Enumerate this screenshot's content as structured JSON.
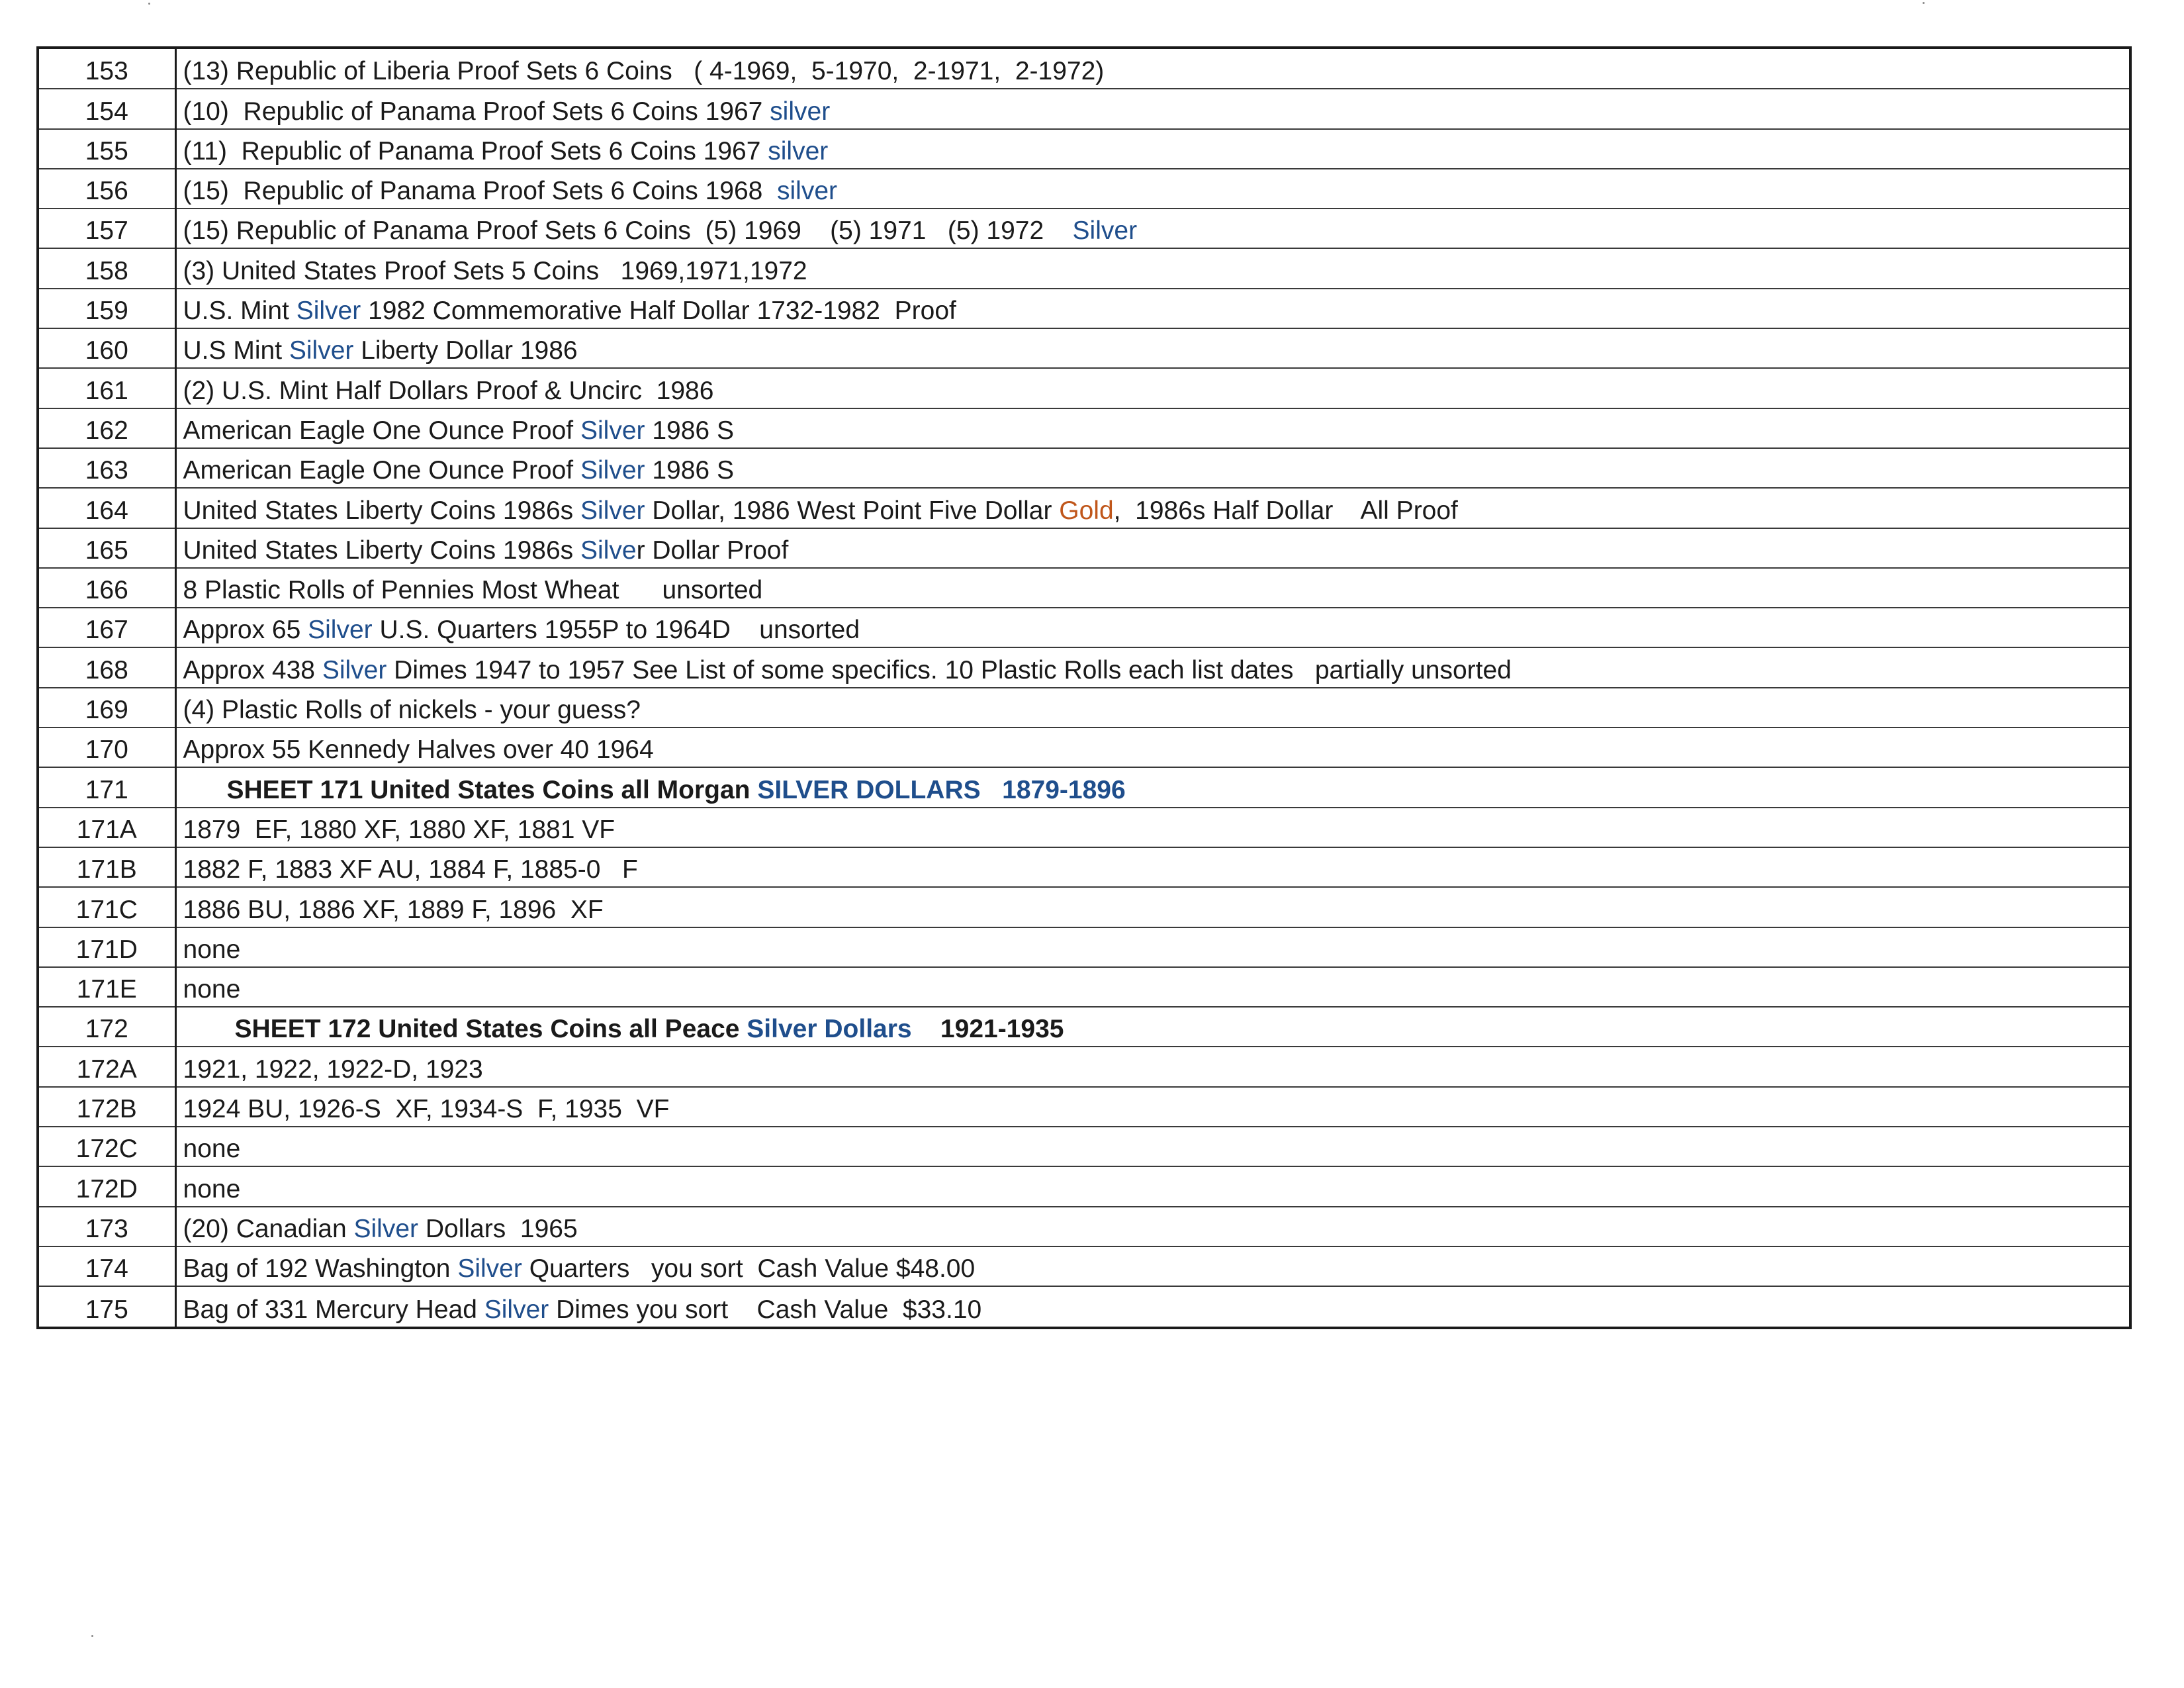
{
  "rows": [
    {
      "lot": "153",
      "desc": [
        {
          "t": "(13) Republic of Liberia Proof Sets 6 Coins   ( 4-1969,  5-1970,  2-1971,  2-1972)"
        }
      ]
    },
    {
      "lot": "154",
      "desc": [
        {
          "t": "(10)  Republic of Panama Proof Sets 6 Coins 1967 "
        },
        {
          "t": "silver",
          "c": "silver"
        }
      ]
    },
    {
      "lot": "155",
      "desc": [
        {
          "t": "(11)  Republic of Panama Proof Sets 6 Coins 1967 "
        },
        {
          "t": "silver",
          "c": "silver"
        }
      ]
    },
    {
      "lot": "156",
      "desc": [
        {
          "t": "(15)  Republic of Panama Proof Sets 6 Coins 1968  "
        },
        {
          "t": "silver",
          "c": "silver"
        }
      ]
    },
    {
      "lot": "157",
      "desc": [
        {
          "t": "(15) Republic of Panama Proof Sets 6 Coins  (5) 1969    (5) 1971   (5) 1972    "
        },
        {
          "t": "Silver",
          "c": "silver"
        }
      ]
    },
    {
      "lot": "158",
      "desc": [
        {
          "t": "(3) United States Proof Sets 5 Coins   1969,1971,1972"
        }
      ]
    },
    {
      "lot": "159",
      "desc": [
        {
          "t": "U.S. Mint "
        },
        {
          "t": "Silver",
          "c": "silver"
        },
        {
          "t": " 1982 Commemorative Half Dollar 1732-1982  Proof"
        }
      ]
    },
    {
      "lot": "160",
      "desc": [
        {
          "t": "U.S Mint "
        },
        {
          "t": "Silver",
          "c": "silver"
        },
        {
          "t": " Liberty Dollar 1986"
        }
      ]
    },
    {
      "lot": "161",
      "desc": [
        {
          "t": "(2) U.S. Mint Half Dollars Proof & Uncirc  1986"
        }
      ]
    },
    {
      "lot": "162",
      "desc": [
        {
          "t": "American Eagle One Ounce Proof "
        },
        {
          "t": "Silver",
          "c": "silver"
        },
        {
          "t": " 1986 S"
        }
      ]
    },
    {
      "lot": "163",
      "desc": [
        {
          "t": "American Eagle One Ounce Proof "
        },
        {
          "t": "Silver",
          "c": "silver"
        },
        {
          "t": " 1986 S"
        }
      ]
    },
    {
      "lot": "164",
      "desc": [
        {
          "t": "United States Liberty Coins 1986s "
        },
        {
          "t": "Silver",
          "c": "silver"
        },
        {
          "t": " Dollar, 1986 West Point Five Dollar "
        },
        {
          "t": "Gold",
          "c": "gold"
        },
        {
          "t": ",  1986s Half Dollar    All Proof"
        }
      ]
    },
    {
      "lot": "165",
      "desc": [
        {
          "t": "United States Liberty Coins 1986s "
        },
        {
          "t": "Silve",
          "c": "silver"
        },
        {
          "t": "r Dollar Proof"
        }
      ]
    },
    {
      "lot": "166",
      "desc": [
        {
          "t": "8 Plastic Rolls of Pennies Most Wheat      unsorted"
        }
      ]
    },
    {
      "lot": "167",
      "desc": [
        {
          "t": "Approx 65 "
        },
        {
          "t": "Silver",
          "c": "silver"
        },
        {
          "t": " U.S. Quarters 1955P to 1964D    unsorted"
        }
      ]
    },
    {
      "lot": "168",
      "desc": [
        {
          "t": "Approx 438 "
        },
        {
          "t": "Silver",
          "c": "silver"
        },
        {
          "t": " Dimes 1947 to 1957 See List of some specifics. 10 Plastic Rolls each list dates   partially unsorted"
        }
      ]
    },
    {
      "lot": "169",
      "desc": [
        {
          "t": "(4) Plastic Rolls of nickels - your guess?"
        }
      ]
    },
    {
      "lot": "170",
      "desc": [
        {
          "t": "Approx 55 Kennedy Halves over 40 1964"
        }
      ]
    },
    {
      "lot": "171",
      "heading": true,
      "desc": [
        {
          "t": "SHEET 171 United States Coins all Morgan "
        },
        {
          "t": "SILVER DOLLARS   1879-1896",
          "c": "silver"
        }
      ]
    },
    {
      "lot": "171A",
      "desc": [
        {
          "t": "1879  EF, 1880 XF, 1880 XF, 1881 VF"
        }
      ]
    },
    {
      "lot": "171B",
      "desc": [
        {
          "t": "1882 F, 1883 XF AU, 1884 F, 1885-0   F"
        }
      ]
    },
    {
      "lot": "171C",
      "desc": [
        {
          "t": "1886 BU, 1886 XF, 1889 F, 1896  XF"
        }
      ]
    },
    {
      "lot": "171D",
      "desc": [
        {
          "t": "none"
        }
      ]
    },
    {
      "lot": "171E",
      "desc": [
        {
          "t": "none"
        }
      ]
    },
    {
      "lot": "172",
      "heading": true,
      "desc": [
        {
          "t": "SHEET 172 United States Coins all Peace "
        },
        {
          "t": "Silver Dollars",
          "c": "silver"
        },
        {
          "t": "    1921-1935"
        }
      ]
    },
    {
      "lot": "172A",
      "desc": [
        {
          "t": "1921, 1922, 1922-D, 1923"
        }
      ]
    },
    {
      "lot": "172B",
      "desc": [
        {
          "t": "1924 BU, 1926-S  XF, 1934-S  F, 1935  VF"
        }
      ]
    },
    {
      "lot": "172C",
      "desc": [
        {
          "t": "none"
        }
      ]
    },
    {
      "lot": "172D",
      "desc": [
        {
          "t": "none"
        }
      ]
    },
    {
      "lot": "173",
      "desc": [
        {
          "t": "(20) Canadian "
        },
        {
          "t": "Silver",
          "c": "silver"
        },
        {
          "t": " Dollars  1965"
        }
      ]
    },
    {
      "lot": "174",
      "desc": [
        {
          "t": "Bag of 192 Washington "
        },
        {
          "t": "Silver",
          "c": "silver"
        },
        {
          "t": " Quarters   you sort  Cash Value $48.00"
        }
      ]
    },
    {
      "lot": "175",
      "desc": [
        {
          "t": "Bag of 331 Mercury Head "
        },
        {
          "t": "Silver",
          "c": "silver"
        },
        {
          "t": " Dimes you sort    Cash Value  $33.10"
        }
      ]
    }
  ],
  "colors": {
    "silver": "#1f4e8c",
    "gold": "#c0561a",
    "text": "#1a1a1a"
  }
}
